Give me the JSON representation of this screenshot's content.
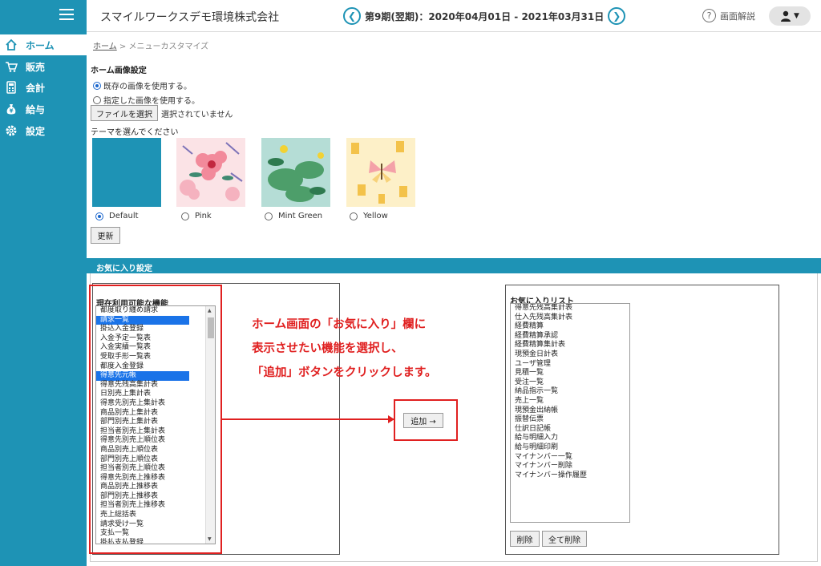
{
  "header": {
    "company": "スマイルワークスデモ環境株式会社",
    "period": "第9期(翌期)：2020年04月01日 - 2021年03月31日",
    "prev_icon": "chevron-left-icon",
    "next_icon": "chevron-right-icon",
    "help_label": "画面解説",
    "user_icon": "user-icon"
  },
  "sidebar": {
    "items": [
      {
        "label": "ホーム",
        "icon": "home-icon"
      },
      {
        "label": "販売",
        "icon": "cart-icon"
      },
      {
        "label": "会計",
        "icon": "calculator-icon"
      },
      {
        "label": "給与",
        "icon": "money-bag-icon"
      },
      {
        "label": "設定",
        "icon": "gear-icon"
      }
    ]
  },
  "breadcrumb": {
    "home": "ホーム",
    "separator": ">",
    "current": "メニューカスタマイズ"
  },
  "home_image": {
    "title": "ホーム画像設定",
    "option_existing": "既存の画像を使用する。",
    "option_custom": "指定した画像を使用する。",
    "file_button": "ファイルを選択",
    "file_status": "選択されていません",
    "theme_title": "テーマを選んでください",
    "themes": [
      "Default",
      "Pink",
      "Mint Green",
      "Yellow"
    ],
    "update_button": "更新"
  },
  "favorites": {
    "band_title": "お気に入り設定",
    "available_title": "現在利用可能な機能",
    "available_items": [
      "都度取り纏め請求",
      "請求一覧",
      "掛込入金登録",
      "入金予定一覧表",
      "入金実績一覧表",
      "受取手形一覧表",
      "都度入金登録",
      "得意先元帳",
      "得意先残高集計表",
      "日別売上集計表",
      "得意先別売上集計表",
      "商品別売上集計表",
      "部門別売上集計表",
      "担当者別売上集計表",
      "得意先別売上順位表",
      "商品別売上順位表",
      "部門別売上順位表",
      "担当者別売上順位表",
      "得意先別売上推移表",
      "商品別売上推移表",
      "部門別売上推移表",
      "担当者別売上推移表",
      "売上総括表",
      "請求受け一覧",
      "支払一覧",
      "掛払支払登録"
    ],
    "selected_items": [
      "請求一覧",
      "得意先元帳"
    ],
    "add_button": "追加 →",
    "favorites_title": "お気に入りリスト",
    "favorite_items": [
      "得意先残高集計表",
      "仕入先残高集計表",
      "経費精算",
      "経費精算承認",
      "経費精算集計表",
      "現預金日計表",
      "ユーザ管理",
      "見積一覧",
      "受注一覧",
      "納品指示一覧",
      "売上一覧",
      "現預金出納帳",
      "振替伝票",
      "仕訳日記帳",
      "給与明細入力",
      "給与明細印刷",
      "マイナンバー一覧",
      "マイナンバー削除",
      "マイナンバー操作履歴"
    ],
    "delete_button": "削除",
    "delete_all_button": "全て削除"
  },
  "annotation": {
    "lines": [
      "ホーム画面の「お気に入り」欄に",
      "表示させたい機能を選択し、",
      "「追加」ボタンをクリックします。"
    ],
    "color": "#e02020"
  },
  "colors": {
    "accent": "#1e93b5",
    "selection": "#1a73e8"
  }
}
